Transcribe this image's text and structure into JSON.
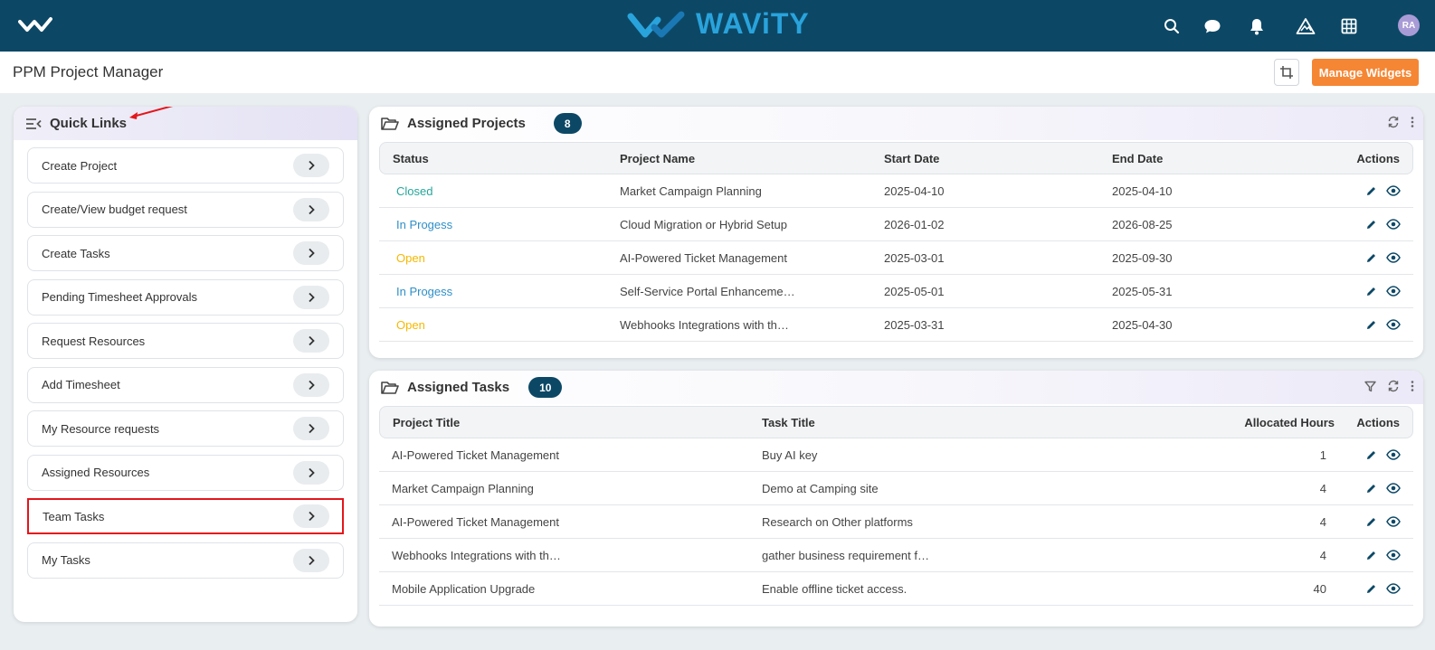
{
  "brand": {
    "name": "WAViTY",
    "colors": {
      "topbar": "#0c4866",
      "accent": "#29a3dc",
      "action": "#f58634"
    }
  },
  "topbar": {
    "icons": [
      "search-icon",
      "chat-icon",
      "bell-icon",
      "alert-triangle-icon",
      "grid-icon"
    ],
    "avatar_initials": "RA"
  },
  "page": {
    "title": "PPM Project Manager",
    "manage_widgets_label": "Manage Widgets"
  },
  "quick_links": {
    "title": "Quick Links",
    "items": [
      {
        "label": "Create Project"
      },
      {
        "label": "Create/View budget request"
      },
      {
        "label": "Create Tasks"
      },
      {
        "label": "Pending Timesheet Approvals"
      },
      {
        "label": "Request Resources"
      },
      {
        "label": "Add Timesheet"
      },
      {
        "label": "My Resource requests"
      },
      {
        "label": "Assigned Resources"
      },
      {
        "label": "Team Tasks"
      },
      {
        "label": "My Tasks"
      }
    ]
  },
  "assigned_projects": {
    "title": "Assigned Projects",
    "count": "8",
    "columns": [
      "Status",
      "Project Name",
      "Start Date",
      "End Date",
      "Actions"
    ],
    "rows": [
      {
        "status": "Closed",
        "name": "Market Campaign Planning",
        "start": "2025-04-10",
        "end": "2025-04-10"
      },
      {
        "status": "In Progess",
        "name": "Cloud Migration or Hybrid Setup",
        "start": "2026-01-02",
        "end": "2026-08-25"
      },
      {
        "status": "Open",
        "name": "AI-Powered Ticket Management",
        "start": "2025-03-01",
        "end": "2025-09-30"
      },
      {
        "status": "In Progess",
        "name": "Self-Service Portal Enhanceme…",
        "start": "2025-05-01",
        "end": "2025-05-31"
      },
      {
        "status": "Open",
        "name": "Webhooks Integrations with th…",
        "start": "2025-03-31",
        "end": "2025-04-30"
      }
    ]
  },
  "assigned_tasks": {
    "title": "Assigned Tasks",
    "count": "10",
    "columns": [
      "Project Title",
      "Task Title",
      "Allocated Hours",
      "Actions"
    ],
    "rows": [
      {
        "project": "AI-Powered Ticket Management",
        "task": "Buy AI key",
        "hours": "1"
      },
      {
        "project": "Market Campaign Planning",
        "task": "Demo at Camping site",
        "hours": "4"
      },
      {
        "project": "AI-Powered Ticket Management",
        "task": "Research on Other platforms",
        "hours": "4"
      },
      {
        "project": "Webhooks Integrations with th…",
        "task": "gather business requirement f…",
        "hours": "4"
      },
      {
        "project": "Mobile Application Upgrade",
        "task": "Enable offline ticket access.",
        "hours": "40"
      }
    ]
  }
}
